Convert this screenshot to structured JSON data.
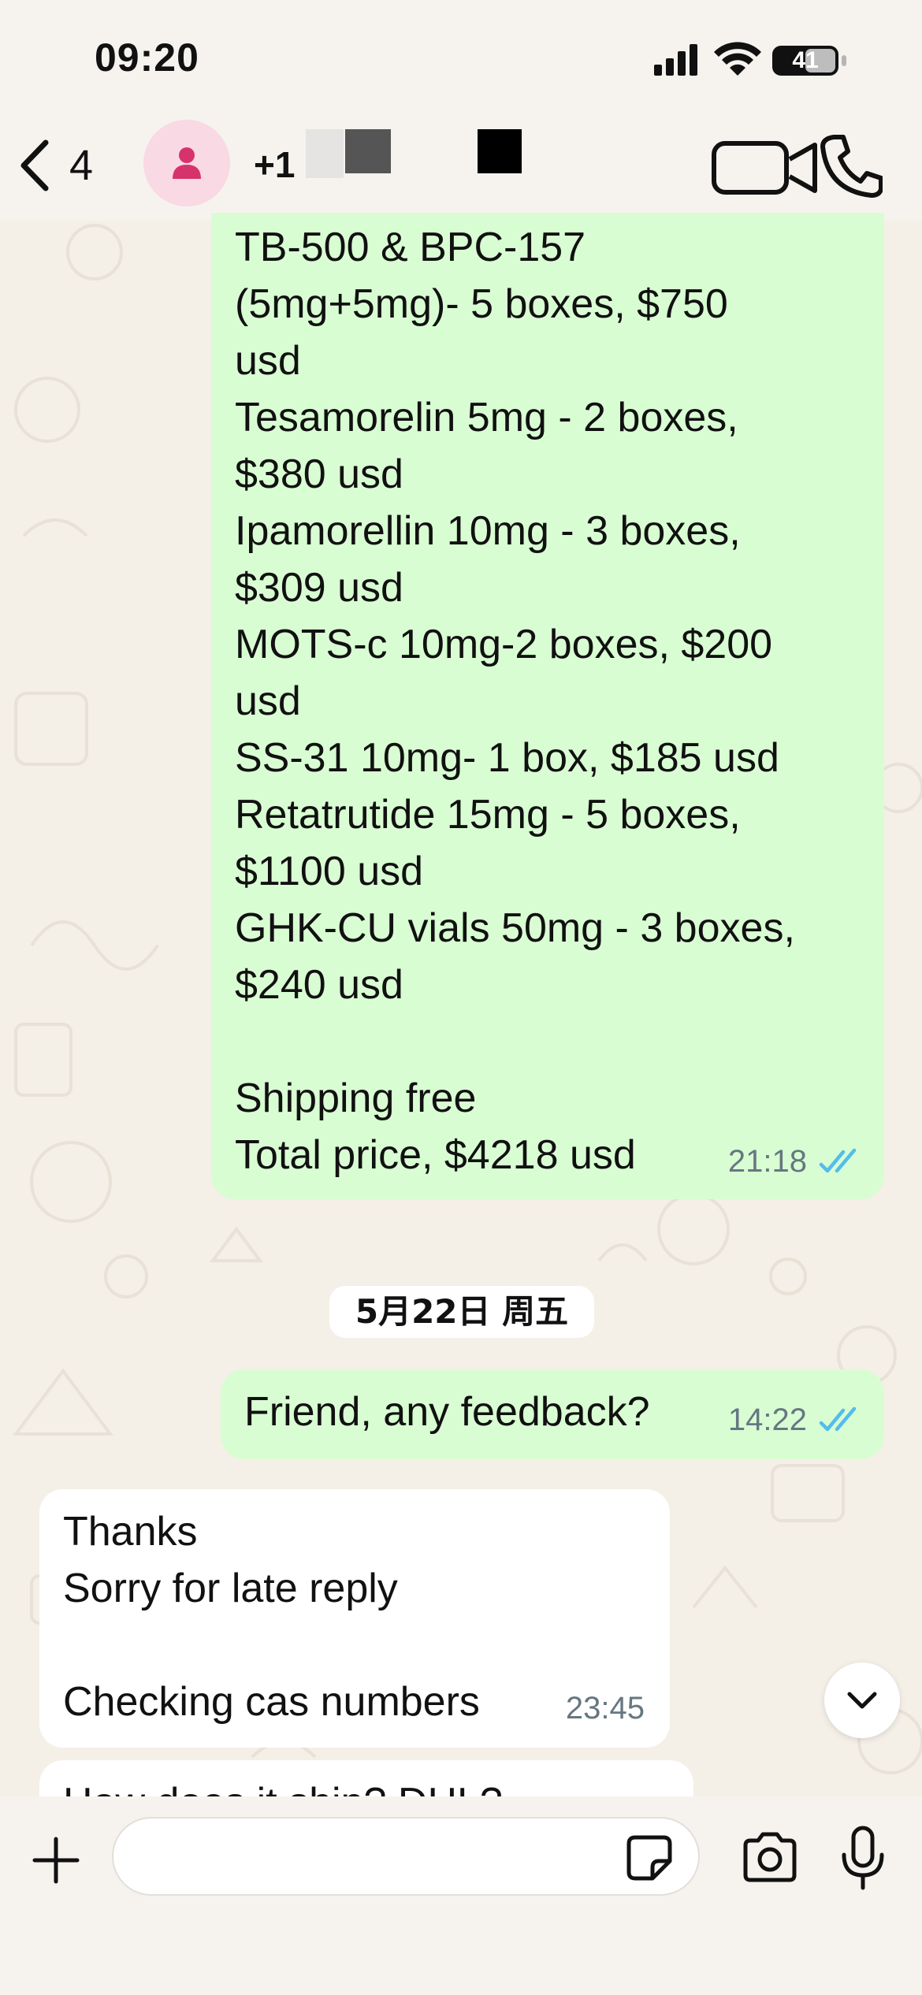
{
  "status_bar": {
    "time": "09:20",
    "battery": "41"
  },
  "header": {
    "back_count": "4",
    "contact_name": "+1"
  },
  "messages": [
    {
      "direction": "outgoing",
      "lines": [
        "TB-500 & BPC-157",
        "(5mg+5mg)- 5 boxes, $750",
        "usd",
        "Tesamorelin 5mg - 2 boxes,",
        "$380 usd",
        "Ipamorellin 10mg - 3 boxes,",
        "$309 usd",
        "MOTS-c 10mg-2 boxes, $200",
        "usd",
        "SS-31 10mg- 1 box, $185 usd",
        "Retatrutide 15mg - 5 boxes,",
        "$1100 usd",
        "GHK-CU vials 50mg - 3 boxes,",
        "$240 usd",
        "",
        "Shipping free",
        "Total price, $4218 usd"
      ],
      "time": "21:18",
      "status": "read"
    },
    {
      "direction": "outgoing",
      "lines": [
        "Friend, any feedback?"
      ],
      "time": "14:22",
      "status": "read"
    },
    {
      "direction": "incoming",
      "lines": [
        "Thanks",
        "Sorry for late reply",
        "",
        "Checking cas numbers"
      ],
      "time": "23:45"
    },
    {
      "direction": "incoming",
      "lines": [
        "How does it ship? DHL?"
      ]
    }
  ],
  "date_separator": "5月22日 周五",
  "colors": {
    "outgoing_bubble": "#d9fdd3",
    "incoming_bubble": "#ffffff",
    "read_ticks": "#53bdeb",
    "meta_text": "#667781",
    "avatar_bg": "#f9d9e4",
    "avatar_icon": "#d6336c"
  },
  "icons": {
    "back": "chevron-left-icon",
    "avatar": "person-icon",
    "video": "video-camera-icon",
    "call": "phone-icon",
    "scroll": "chevron-down-icon",
    "plus": "plus-icon",
    "sticker": "sticker-icon",
    "camera": "camera-icon",
    "mic": "microphone-icon"
  }
}
